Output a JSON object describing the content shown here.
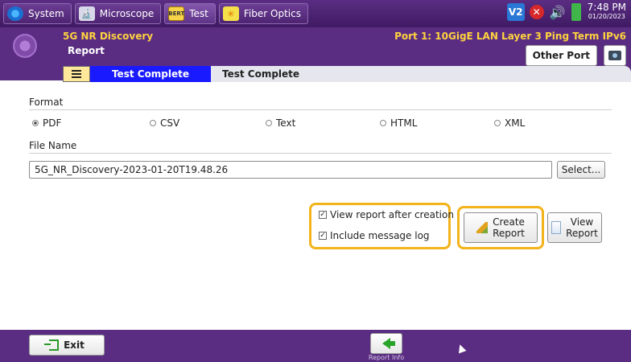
{
  "taskbar": {
    "tabs": [
      {
        "label": "System",
        "icon": "globe-icon"
      },
      {
        "label": "Microscope",
        "icon": "microscope-icon"
      },
      {
        "label": "Test",
        "icon": "bert-icon",
        "badge": "BERT"
      },
      {
        "label": "Fiber Optics",
        "icon": "fiber-icon"
      }
    ],
    "tray": {
      "v2_label": "V2",
      "time": "7:48 PM",
      "date": "01/20/2023"
    }
  },
  "header": {
    "app_name": "5G NR Discovery",
    "page": "Report",
    "port": "Port 1: 10GigE LAN Layer 3 Ping Term IPv6",
    "other_port_label": "Other Port"
  },
  "tabs": {
    "active_label": "Test Complete",
    "status_label": "Test Complete"
  },
  "format": {
    "label": "Format",
    "options": [
      "PDF",
      "CSV",
      "Text",
      "HTML",
      "XML"
    ],
    "selected": "PDF"
  },
  "file": {
    "label": "File Name",
    "value": "5G_NR_Discovery-2023-01-20T19.48.26",
    "select_label": "Select..."
  },
  "options": {
    "view_after": "View report after creation",
    "include_log": "Include message log",
    "view_after_checked": true,
    "include_log_checked": true
  },
  "actions": {
    "create_line1": "Create",
    "create_line2": "Report",
    "view_line1": "View",
    "view_line2": "Report"
  },
  "bottom": {
    "exit_label": "Exit",
    "report_info_label": "Report Info"
  },
  "colors": {
    "purple": "#5a2d82",
    "accent_yellow": "#ffd23f",
    "highlight": "#f3b31a",
    "tab_blue": "#1a1aff"
  }
}
